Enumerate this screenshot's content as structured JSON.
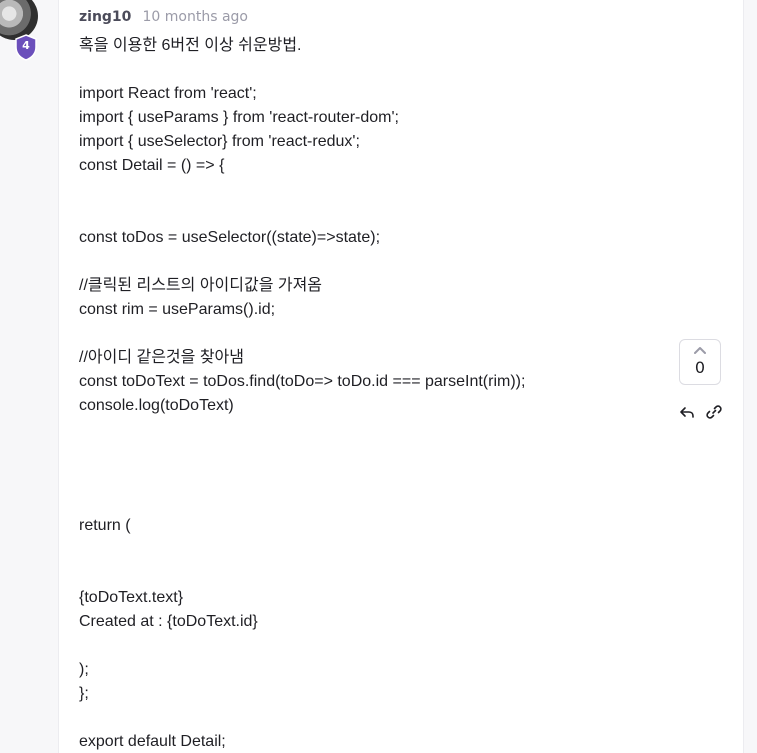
{
  "comment": {
    "username": "zing10",
    "time_ago": "10 months ago",
    "level": "4",
    "vote_count": "0",
    "lines": [
      "혹을 이용한 6버전 이상 쉬운방법.",
      "",
      "import React from 'react';",
      "import { useParams } from 'react-router-dom';",
      "import { useSelector} from 'react-redux';",
      "const Detail = () => {",
      "",
      "",
      "const toDos = useSelector((state)=>state);",
      "",
      "//클릭된 리스트의 아이디값을 가져옴",
      "const rim = useParams().id;",
      "",
      "//아이디 같은것을 찾아냄",
      "const toDoText = toDos.find(toDo=> toDo.id === parseInt(rim));",
      "console.log(toDoText)",
      "",
      "",
      "",
      "",
      "return (",
      "",
      "",
      "{toDoText.text}",
      "Created at : {toDoText.id}",
      "",
      ");",
      "};",
      "",
      "export default Detail;"
    ]
  },
  "icons": {
    "avatar": "avatar-image",
    "badge": "shield-badge-icon",
    "upvote": "chevron-up-icon",
    "reply": "reply-icon",
    "link": "link-icon"
  },
  "colors": {
    "badge": "#6b4fbb",
    "username": "#4b4b5a",
    "timeago": "#9b9ba8",
    "text": "#1f1f24"
  }
}
